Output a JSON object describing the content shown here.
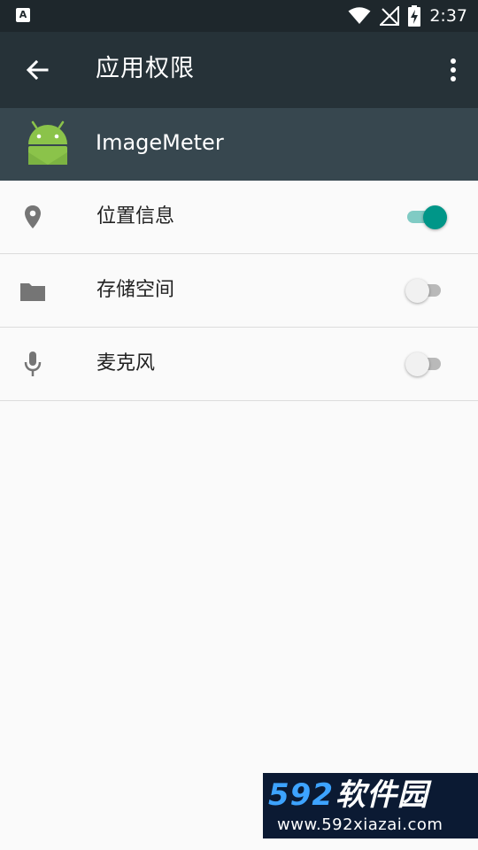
{
  "status_bar": {
    "time": "2:37",
    "icons": [
      "notification-a-icon",
      "wifi-icon",
      "no-signal-icon",
      "battery-charging-icon"
    ]
  },
  "app_bar": {
    "title": "应用权限",
    "back_icon": "arrow-back-icon",
    "overflow_icon": "more-vert-icon"
  },
  "app_header": {
    "app_name": "ImageMeter",
    "icon": "android-icon"
  },
  "permissions": [
    {
      "label": "位置信息",
      "icon": "location-pin-icon",
      "enabled": true
    },
    {
      "label": "存储空间",
      "icon": "folder-icon",
      "enabled": false
    },
    {
      "label": "麦克风",
      "icon": "microphone-icon",
      "enabled": false
    }
  ],
  "watermark": {
    "number": "592",
    "name": "软件园",
    "url": "www.592xiazai.com"
  },
  "colors": {
    "status_bar": "#1e272c",
    "app_bar": "#263238",
    "app_header": "#37474f",
    "accent": "#009688",
    "background": "#fafafa"
  }
}
